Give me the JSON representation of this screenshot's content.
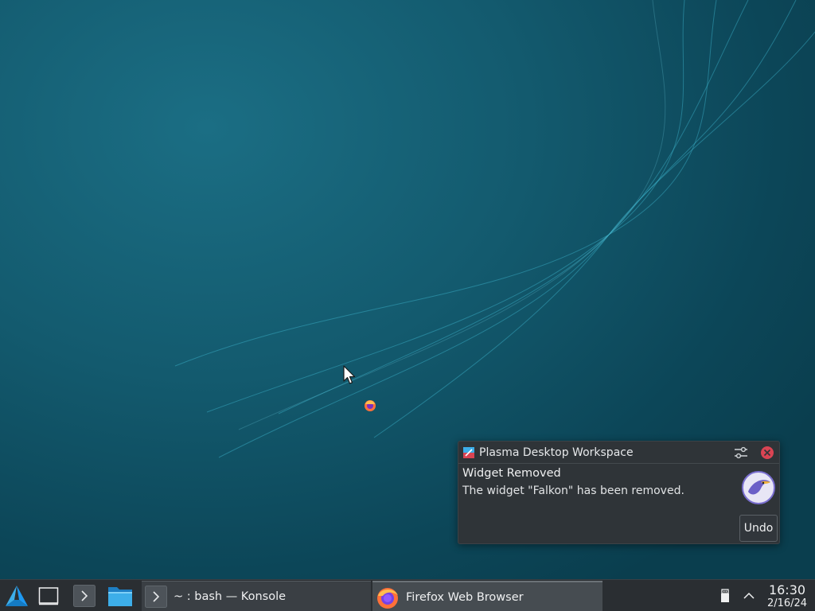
{
  "desktop": {
    "icons": [
      "firefox-icon"
    ]
  },
  "notification": {
    "app_name": "Plasma Desktop Workspace",
    "summary": "Widget Removed",
    "body": "The widget \"Falkon\" has been removed.",
    "action_label": "Undo",
    "icons": [
      "plasma-icon",
      "configure-icon",
      "close-icon",
      "falkon-icon"
    ]
  },
  "taskbar": {
    "launchers": [
      "app-menu-icon",
      "show-desktop-icon",
      "konsole-launcher-icon",
      "dolphin-launcher-icon"
    ],
    "tasks": [
      {
        "title": "~ : bash — Konsole",
        "icon": "konsole-icon",
        "active": false
      },
      {
        "title": "Firefox Web Browser",
        "icon": "firefox-icon",
        "active": true
      }
    ],
    "tray": {
      "icons": [
        "usb-device-icon",
        "chevron-up-icon"
      ],
      "time": "16:30",
      "date": "2/16/24"
    }
  },
  "colors": {
    "wallpaper": "#135a6e",
    "panel": "#2a2e32",
    "notification_bg": "#2f3438",
    "close_red": "#da4453",
    "accent": "#1d99f3"
  }
}
